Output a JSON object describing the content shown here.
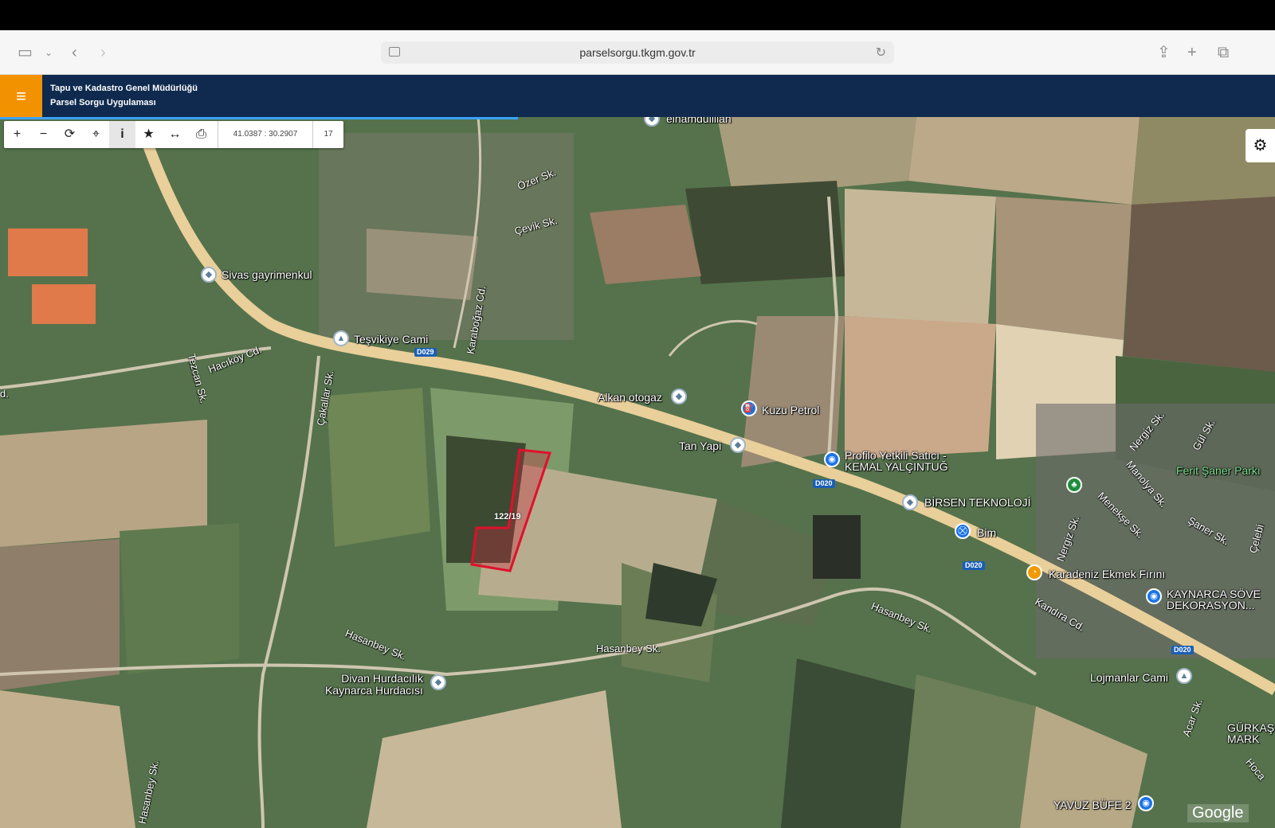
{
  "browser": {
    "url": "parselsorgu.tkgm.gov.tr",
    "icons": [
      "sidebar-icon",
      "chevron-down-icon",
      "back-icon",
      "forward-icon",
      "reload-icon",
      "share-icon",
      "new-tab-icon",
      "tabs-icon"
    ]
  },
  "app": {
    "title_line1": "Tapu ve Kadastro Genel Müdürlüğü",
    "title_line2": "Parsel Sorgu Uygulaması",
    "menu_icon": "hamburger-icon",
    "accent_color": "#f39200",
    "header_color": "#0f2a4e"
  },
  "toolbar": {
    "buttons": [
      "zoom-in",
      "zoom-out",
      "refresh",
      "locate",
      "info",
      "favorite",
      "measure",
      "print"
    ],
    "coordinates": "41.0387 : 30.2907",
    "zoom_level": "17"
  },
  "map": {
    "parcel_label": "122/19",
    "places": {
      "elhamdulillah": "elhamdulillah",
      "sivas": "Sivas gayrimenkul",
      "tesvikiye": "Teşvikiye Cami",
      "alkan": "Alkan otogaz",
      "kuzu": "Kuzu Petrol",
      "tan": "Tan Yapi",
      "profilo1": "Profilo Yetkili Satıcı -",
      "profilo2": "KEMAL YALÇINTUĞ",
      "birsen": "BİRSEN TEKNOLOJİ",
      "bim": "Bim",
      "karadeniz": "Karadeniz Ekmek Fırını",
      "kaynarca1": "KAYNARCA SÖVE",
      "kaynarca2": "DEKORASYON...",
      "divan1": "Divan Hurdacılık",
      "divan2": "Kaynarca Hurdacısı",
      "lojmanlar": "Lojmanlar Cami",
      "ferit": "Ferit Şaner Parkı",
      "gurkas1": "GÜRKAŞ Y",
      "gurkas2": "MARK",
      "yavuz": "YAVUZ BÜFE 2"
    },
    "roads": {
      "ozer": "Özer Sk.",
      "cevik": "Çevik Sk.",
      "karabogaz": "Karaboğaz Cd.",
      "tezcan": "Tezcan Sk.",
      "hacikoy": "Hacıköy Cd.",
      "cakallar": "Çakallar Sk.",
      "hasanbey1": "Hasanbey Sk.",
      "hasanbey2": "Hasanbey Sk.",
      "hasanbey3": "Hasanbey Sk.",
      "hasanbey4": "Hasanbey Sk.",
      "kandira": "Kandıra Cd.",
      "nergiz1": "Nergiz Sk.",
      "nergiz2": "Nergiz Sk.",
      "manolya": "Manolya Sk.",
      "menekse": "Menekşe Sk.",
      "saner": "Şaner Sk.",
      "gul": "Gül Sk.",
      "celebi": "Çelebi",
      "acar": "Acar Sk.",
      "hoca": "Hoca",
      "d029": "D029",
      "d020a": "D020",
      "d020b": "D020",
      "d020c": "D020",
      "d": "d."
    },
    "attribution": "Google"
  }
}
